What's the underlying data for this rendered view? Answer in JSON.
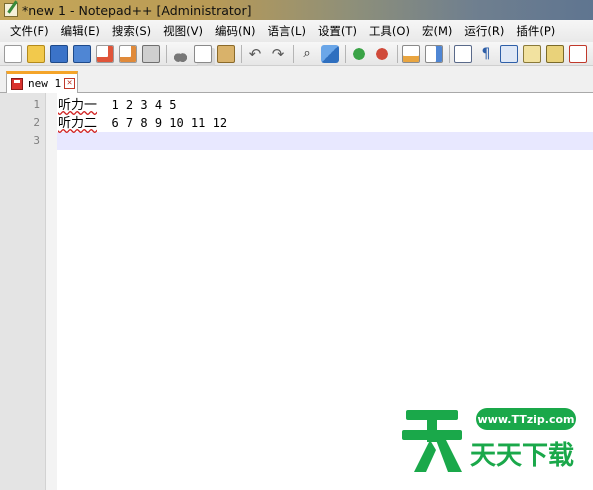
{
  "window": {
    "title": "*new 1 - Notepad++ [Administrator]"
  },
  "menu": [
    "文件(F)",
    "编辑(E)",
    "搜索(S)",
    "视图(V)",
    "编码(N)",
    "语言(L)",
    "设置(T)",
    "工具(O)",
    "宏(M)",
    "运行(R)",
    "插件(P)"
  ],
  "toolbar": {
    "icons": [
      "new-file-icon",
      "open-file-icon",
      "save-icon",
      "save-all-icon",
      "close-icon",
      "close-all-icon",
      "print-icon",
      "cut-icon",
      "copy-icon",
      "paste-icon",
      "undo-icon",
      "redo-icon",
      "find-icon",
      "replace-icon",
      "zoom-in-icon",
      "zoom-out-icon",
      "sync-vertical-icon",
      "sync-horizontal-icon",
      "word-wrap-icon",
      "show-all-chars-icon",
      "indent-guide-icon",
      "doc-map-icon",
      "function-list-icon",
      "folder-workspace-icon"
    ]
  },
  "tabs": [
    {
      "label": "new 1",
      "active": true
    }
  ],
  "editor": {
    "lines": [
      {
        "number": "1",
        "label": "听力一",
        "values": "  1 2 3 4 5"
      },
      {
        "number": "2",
        "label": "听力二",
        "values": "  6 7 8 9 10 11 12"
      },
      {
        "number": "3",
        "label": "",
        "values": ""
      }
    ],
    "current_line": 3
  },
  "watermark": {
    "url": "www.TTzip.com",
    "brand": "天天下载",
    "color": "#1aa84a"
  }
}
